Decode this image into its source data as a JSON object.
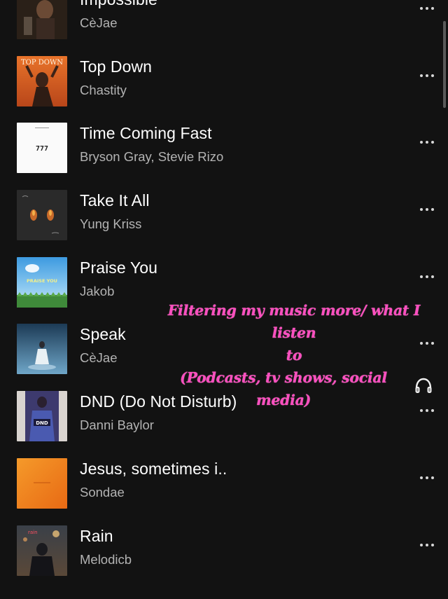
{
  "tracks": [
    {
      "title": "Impossible",
      "artist": "CèJae",
      "art": "dark-portrait"
    },
    {
      "title": "Top Down",
      "artist": "Chastity",
      "art": "orange-portrait",
      "art_text": "TOP DOWN"
    },
    {
      "title": "Time Coming Fast",
      "artist": "Bryson Gray, Stevie Rizo",
      "art": "white-777",
      "art_text": "777"
    },
    {
      "title": "Take It All",
      "artist": "Yung Kriss",
      "art": "dark-hands"
    },
    {
      "title": "Praise You",
      "artist": "Jakob",
      "art": "sky-field",
      "art_text": "PRAISE YOU"
    },
    {
      "title": "Speak",
      "artist": "CèJae",
      "art": "blue-figure"
    },
    {
      "title": "DND (Do Not Disturb)",
      "artist": "Danni Baylor",
      "art": "purple-dnd",
      "art_text": "DND"
    },
    {
      "title": "Jesus, sometimes i..",
      "artist": "Sondae",
      "art": "orange-plain"
    },
    {
      "title": "Rain",
      "artist": "Melodicb",
      "art": "rain-street"
    }
  ],
  "overlay": {
    "line1": "Filtering my music more/ what I listen",
    "line2": "to",
    "line3": "(Podcasts, tv shows, social media)",
    "emoji_icon": "headphones-icon"
  },
  "colors": {
    "background": "#121212",
    "title": "#ffffff",
    "artist": "#b3b3b3",
    "overlay_text": "#ff4fc0"
  }
}
